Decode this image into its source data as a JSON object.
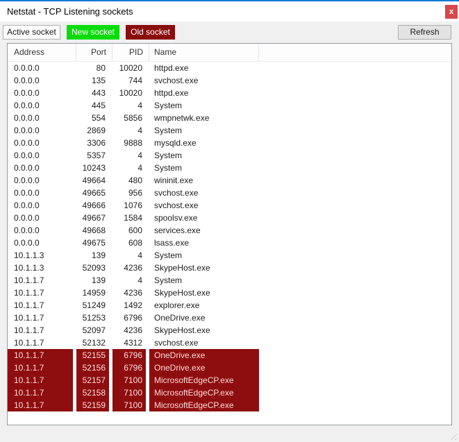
{
  "window": {
    "title": "Netstat - TCP Listening sockets",
    "close_label": "x"
  },
  "toolbar": {
    "buttons": [
      {
        "id": "active-socket",
        "label": "Active socket"
      },
      {
        "id": "new-socket",
        "label": "New socket"
      },
      {
        "id": "old-socket",
        "label": "Old socket"
      }
    ],
    "refresh_label": "Refresh"
  },
  "table": {
    "columns": [
      "Address",
      "Port",
      "PID",
      "Name"
    ],
    "rows": [
      {
        "address": "0.0.0.0",
        "port": "80",
        "pid": "10020",
        "name": "httpd.exe",
        "old": false
      },
      {
        "address": "0.0.0.0",
        "port": "135",
        "pid": "744",
        "name": "svchost.exe",
        "old": false
      },
      {
        "address": "0.0.0.0",
        "port": "443",
        "pid": "10020",
        "name": "httpd.exe",
        "old": false
      },
      {
        "address": "0.0.0.0",
        "port": "445",
        "pid": "4",
        "name": "System",
        "old": false
      },
      {
        "address": "0.0.0.0",
        "port": "554",
        "pid": "5856",
        "name": "wmpnetwk.exe",
        "old": false
      },
      {
        "address": "0.0.0.0",
        "port": "2869",
        "pid": "4",
        "name": "System",
        "old": false
      },
      {
        "address": "0.0.0.0",
        "port": "3306",
        "pid": "9888",
        "name": "mysqld.exe",
        "old": false
      },
      {
        "address": "0.0.0.0",
        "port": "5357",
        "pid": "4",
        "name": "System",
        "old": false
      },
      {
        "address": "0.0.0.0",
        "port": "10243",
        "pid": "4",
        "name": "System",
        "old": false
      },
      {
        "address": "0.0.0.0",
        "port": "49664",
        "pid": "480",
        "name": "wininit.exe",
        "old": false
      },
      {
        "address": "0.0.0.0",
        "port": "49665",
        "pid": "956",
        "name": "svchost.exe",
        "old": false
      },
      {
        "address": "0.0.0.0",
        "port": "49666",
        "pid": "1076",
        "name": "svchost.exe",
        "old": false
      },
      {
        "address": "0.0.0.0",
        "port": "49667",
        "pid": "1584",
        "name": "spoolsv.exe",
        "old": false
      },
      {
        "address": "0.0.0.0",
        "port": "49668",
        "pid": "600",
        "name": "services.exe",
        "old": false
      },
      {
        "address": "0.0.0.0",
        "port": "49675",
        "pid": "608",
        "name": "lsass.exe",
        "old": false
      },
      {
        "address": "10.1.1.3",
        "port": "139",
        "pid": "4",
        "name": "System",
        "old": false
      },
      {
        "address": "10.1.1.3",
        "port": "52093",
        "pid": "4236",
        "name": "SkypeHost.exe",
        "old": false
      },
      {
        "address": "10.1.1.7",
        "port": "139",
        "pid": "4",
        "name": "System",
        "old": false
      },
      {
        "address": "10.1.1.7",
        "port": "14959",
        "pid": "4236",
        "name": "SkypeHost.exe",
        "old": false
      },
      {
        "address": "10.1.1.7",
        "port": "51249",
        "pid": "1492",
        "name": "explorer.exe",
        "old": false
      },
      {
        "address": "10.1.1.7",
        "port": "51253",
        "pid": "6796",
        "name": "OneDrive.exe",
        "old": false
      },
      {
        "address": "10.1.1.7",
        "port": "52097",
        "pid": "4236",
        "name": "SkypeHost.exe",
        "old": false
      },
      {
        "address": "10.1.1.7",
        "port": "52132",
        "pid": "4312",
        "name": "svchost.exe",
        "old": false
      },
      {
        "address": "10.1.1.7",
        "port": "52155",
        "pid": "6796",
        "name": "OneDrive.exe",
        "old": true
      },
      {
        "address": "10.1.1.7",
        "port": "52156",
        "pid": "6796",
        "name": "OneDrive.exe",
        "old": true
      },
      {
        "address": "10.1.1.7",
        "port": "52157",
        "pid": "7100",
        "name": "MicrosoftEdgeCP.exe",
        "old": true
      },
      {
        "address": "10.1.1.7",
        "port": "52158",
        "pid": "7100",
        "name": "MicrosoftEdgeCP.exe",
        "old": true
      },
      {
        "address": "10.1.1.7",
        "port": "52159",
        "pid": "7100",
        "name": "MicrosoftEdgeCP.exe",
        "old": true
      }
    ]
  },
  "colors": {
    "accent_blue": "#0078d7",
    "new_socket_green": "#0adc0a",
    "old_socket_red": "#8b0c0c",
    "old_row_red": "#8e0e0f",
    "old_row_text": "#ffd9d9",
    "close_button_red": "#d5494b"
  }
}
